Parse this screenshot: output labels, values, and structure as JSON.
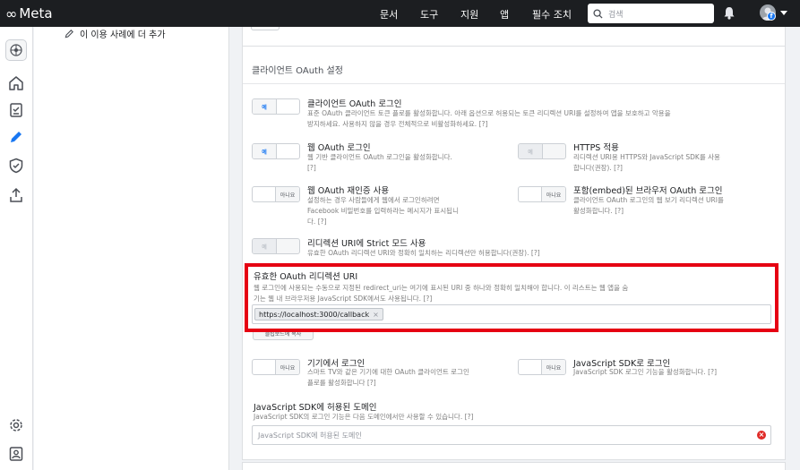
{
  "brand": {
    "name": "Meta",
    "symbol": "∞"
  },
  "nav": {
    "links": [
      "문서",
      "도구",
      "지원",
      "앱",
      "필수 조치"
    ],
    "search_placeholder": "검색"
  },
  "sidebar": {
    "item_label": "이 이용 사례에 더 추가"
  },
  "section": {
    "title": "클라이언트 OAuth 설정"
  },
  "toggles": {
    "on_label": "예",
    "off_label": "아니요"
  },
  "options": {
    "client_login": {
      "title": "클라이언트 OAuth 로그인",
      "desc": "표준 OAuth 클라이언트 토큰 플로를 활성화합니다. 아래 옵션으로 허용되는 토큰 리디렉션 URI를 설정하여 앱을 보호하고 악용을 방지하세요. 사용하지 않을 경우 전체적으로 비활성화하세요.",
      "state": "on"
    },
    "web_login": {
      "title": "웹 OAuth 로그인",
      "desc": "웹 기반 클라이언트 OAuth 로그인을 활성화합니다.",
      "state": "on"
    },
    "https": {
      "title": "HTTPS 적용",
      "desc": "리디렉션 URI용 HTTPS와 JavaScript SDK를 사용합니다(권장).",
      "state": "on-disabled"
    },
    "reauth": {
      "title": "웹 OAuth 재인증 사용",
      "desc": "설정하는 경우 사람들에게 웹에서 로그인하려면 Facebook 비밀번호를 입력하라는 메시지가 표시됩니다.",
      "state": "off"
    },
    "embedded": {
      "title": "포함(embed)된 브라우저 OAuth 로그인",
      "desc": "클라이언트 OAuth 로그인의 웹 보기 리디렉션 URI를 활성화합니다.",
      "state": "off"
    },
    "strict": {
      "title": "리디렉션 URI에 Strict 모드 사용",
      "desc": "유효한 OAuth 리디렉션 URI와 정확히 일치하는 리디렉션만 허용합니다(권장).",
      "state": "on-disabled"
    },
    "device": {
      "title": "기기에서 로그인",
      "desc": "스마트 TV와 같은 기기에 대한 OAuth 클라이언트 로그인 플로를 활성화합니다",
      "state": "off"
    },
    "jssdk": {
      "title": "JavaScript SDK로 로그인",
      "desc": "JavaScript SDK 로그인 기능을 활성화합니다.",
      "state": "off"
    }
  },
  "help": "[?]",
  "redirect": {
    "title": "유효한 OAuth 리디렉션 URI",
    "desc": "웹 로그인에 사용되는 수동으로 지정된 redirect_uri는 여기에 표시된 URI 중 하나와 정확히 일치해야 합니다. 이 리스트는 웹 앱을 숨기는 웹 내 브라우저용 JavaScript SDK에서도 사용됩니다.",
    "uri": "https://localhost:3000/callback",
    "remove": "×",
    "under_button": "클립보드에 복사"
  },
  "js_domains": {
    "title": "JavaScript SDK에 허용된 도메인",
    "desc": "JavaScript SDK의 로그인 기능은 다음 도메인에서만 사용할 수 있습니다.",
    "placeholder": "JavaScript SDK에 허용된 도메인",
    "error": "×"
  }
}
